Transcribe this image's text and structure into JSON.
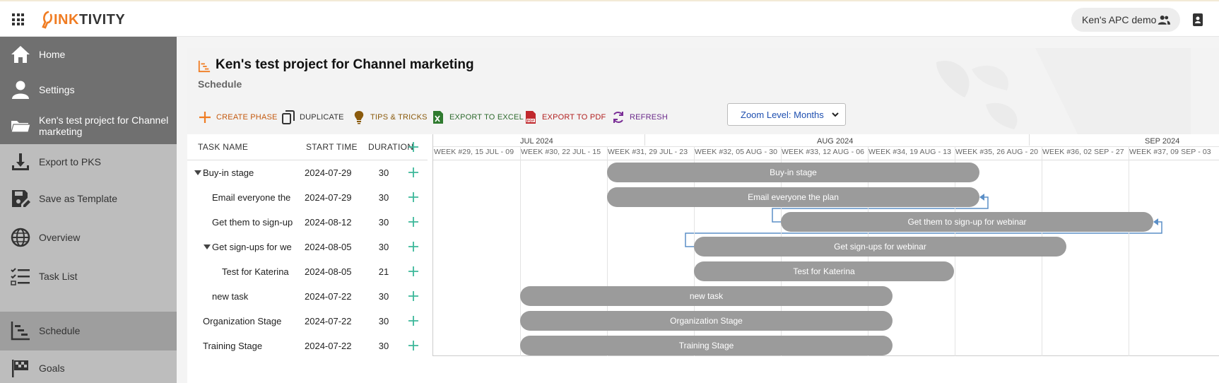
{
  "topbar": {
    "logo_mark": "L",
    "logo_orange": "INK",
    "logo_dark": "TIVITY",
    "org_name": "Ken's APC demo"
  },
  "sidebar": {
    "items": [
      {
        "label": "Home",
        "icon": "home-icon"
      },
      {
        "label": "Settings",
        "icon": "person-icon"
      },
      {
        "label": "Ken's test project for Channel marketing",
        "icon": "folder-icon"
      },
      {
        "label": "Export to PKS",
        "icon": "download-icon"
      },
      {
        "label": "Save as Template",
        "icon": "save-template-icon"
      },
      {
        "label": "Overview",
        "icon": "globe-icon"
      },
      {
        "label": "Task List",
        "icon": "checklist-icon"
      },
      {
        "label": "Schedule",
        "icon": "schedule-icon"
      },
      {
        "label": "Goals",
        "icon": "flag-icon"
      }
    ]
  },
  "project": {
    "title": "Ken's test project for Channel marketing",
    "subtitle": "Schedule"
  },
  "toolbar": {
    "create_phase": "CREATE PHASE",
    "duplicate": "DUPLICATE",
    "tips": "TIPS & TRICKS",
    "export_excel": "EXPORT TO EXCEL",
    "export_pdf": "EXPORT TO PDF",
    "refresh": "REFRESH",
    "zoom_value": "Zoom Level: Months"
  },
  "grid": {
    "col_task": "TASK NAME",
    "col_start": "START TIME",
    "col_duration": "DURATION"
  },
  "timeline": {
    "months": [
      "JUL 2024",
      "AUG 2024",
      "SEP 2024"
    ],
    "weeks": [
      "WEEK #29, 15 JUL - 09",
      "WEEK #30, 22 JUL - 15",
      "WEEK #31, 29 JUL - 23",
      "WEEK #32, 05 AUG - 30",
      "WEEK #33, 12 AUG - 06",
      "WEEK #34, 19 AUG - 13",
      "WEEK #35, 26 AUG - 20",
      "WEEK #36, 02 SEP - 27",
      "WEEK #37, 09 SEP - 03"
    ]
  },
  "tasks": [
    {
      "name": "Buy-in stage",
      "start": "2024-07-29",
      "duration": "30",
      "bar_label": "Buy-in stage"
    },
    {
      "name": "Email everyone the",
      "start": "2024-07-29",
      "duration": "30",
      "bar_label": "Email everyone the plan"
    },
    {
      "name": "Get them to sign-up",
      "start": "2024-08-12",
      "duration": "30",
      "bar_label": "Get them to sign-up for webinar"
    },
    {
      "name": "Get sign-ups for we",
      "start": "2024-08-05",
      "duration": "30",
      "bar_label": "Get sign-ups for webinar"
    },
    {
      "name": "Test for Katerina",
      "start": "2024-08-05",
      "duration": "21",
      "bar_label": "Test for Katerina"
    },
    {
      "name": "new task",
      "start": "2024-07-22",
      "duration": "30",
      "bar_label": "new task"
    },
    {
      "name": "Organization Stage",
      "start": "2024-07-22",
      "duration": "30",
      "bar_label": "Organization Stage"
    },
    {
      "name": "Training Stage",
      "start": "2024-07-22",
      "duration": "30",
      "bar_label": "Training Stage"
    }
  ],
  "colors": {
    "accent_orange": "#f07c22",
    "sidebar_dark": "#707070",
    "sidebar_light": "#bdbdbd",
    "bar_gray": "#9b9b9b",
    "add_green": "#3cb89a",
    "link_blue": "#5b8fc7"
  }
}
